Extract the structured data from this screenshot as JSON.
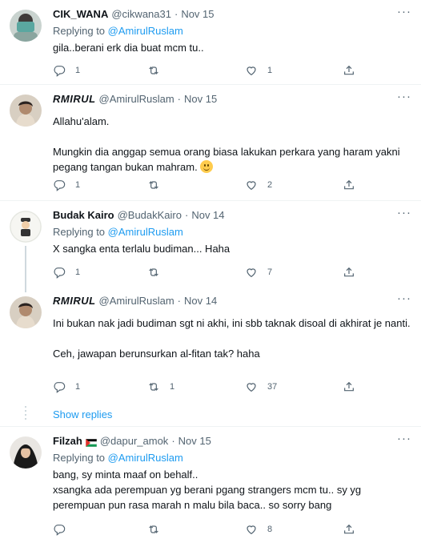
{
  "tweets": [
    {
      "name": "CIK_WANA",
      "handle": "@cikwana31",
      "date": "Nov 15",
      "replying_label": "Replying to",
      "replying_to": "@AmirulRuslam",
      "text": "gila..berani erk dia buat mcm tu..",
      "replies": "1",
      "retweets": "",
      "likes": "1"
    },
    {
      "name": "RMIRUL",
      "handle": "@AmirulRuslam",
      "date": "Nov 15",
      "text": "Allahu'alam.\n\nMungkin dia anggap semua orang biasa lakukan perkara yang haram yakni pegang tangan bukan mahram.",
      "replies": "1",
      "retweets": "",
      "likes": "2"
    },
    {
      "name": "Budak Kairo",
      "handle": "@BudakKairo",
      "date": "Nov 14",
      "replying_label": "Replying to",
      "replying_to": "@AmirulRuslam",
      "text": "X sangka enta terlalu budiman... Haha",
      "replies": "1",
      "retweets": "",
      "likes": "7"
    },
    {
      "name": "RMIRUL",
      "handle": "@AmirulRuslam",
      "date": "Nov 14",
      "text": "Ini bukan nak jadi budiman sgt ni akhi, ini sbb taknak disoal di akhirat je nanti.\n\nCeh, jawapan berunsurkan al-fitan tak? haha",
      "replies": "1",
      "retweets": "1",
      "likes": "37"
    },
    {
      "name": "Filzah",
      "handle": "@dapur_amok",
      "date": "Nov 15",
      "replying_label": "Replying to",
      "replying_to": "@AmirulRuslam",
      "text": "bang, sy minta maaf on behalf..\nxsangka ada perempuan yg berani pgang strangers mcm tu.. sy yg perempuan pun rasa marah n malu bila baca.. so sorry bang",
      "replies": "",
      "retweets": "",
      "likes": "8"
    }
  ],
  "show_replies": "Show replies",
  "icons": {
    "more": "more-icon",
    "reply": "reply-icon",
    "retweet": "retweet-icon",
    "like": "like-icon",
    "share": "share-icon",
    "emoji": "slightly-smiling-face-emoji",
    "flag": "palestine-flag-emoji"
  },
  "colors": {
    "link": "#1d9bf0",
    "secondary_text": "#536471",
    "primary_text": "#0f1419",
    "divider": "#eff3f4"
  }
}
